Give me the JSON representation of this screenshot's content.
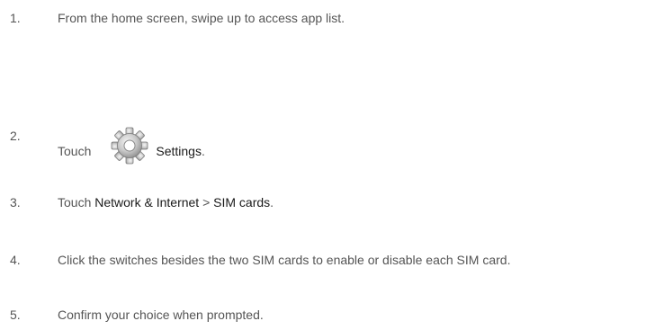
{
  "steps": [
    {
      "number": "1.",
      "text": "From the home screen, swipe up to access app list."
    },
    {
      "number": "2.",
      "prefix": "Touch",
      "icon": "settings-gear-icon",
      "emphasis": "Settings",
      "suffix": "."
    },
    {
      "number": "3.",
      "prefix": "Touch ",
      "emphasis1": "Network & Internet",
      "separator": " > ",
      "emphasis2": "SIM cards",
      "suffix": "."
    },
    {
      "number": "4.",
      "text": "Click the switches besides the two SIM cards to enable or disable each SIM card."
    },
    {
      "number": "5.",
      "text": "Confirm your choice when prompted."
    }
  ]
}
